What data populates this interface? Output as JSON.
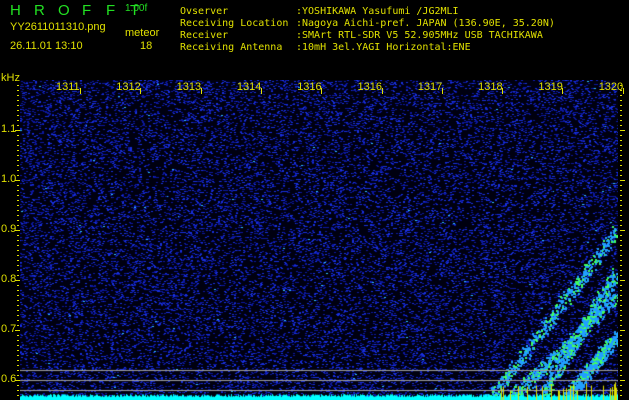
{
  "header": {
    "app_title": "HROFFT",
    "version": "1.00f",
    "filename": "YY2611011310.png",
    "datetime": "26.11.01 13:10",
    "meteor_label": "meteor",
    "meteor_count": "18",
    "info": [
      {
        "label": "Ovserver",
        "value": ":YOSHIKAWA Yasufumi /JG2MLI"
      },
      {
        "label": "Receiving Location",
        "value": ":Nagoya Aichi-pref. JAPAN (136.90E, 35.20N)"
      },
      {
        "label": "Receiver",
        "value": ":SMArt RTL-SDR V5 52.905MHz USB TACHIKAWA"
      },
      {
        "label": "Receiving Antenna",
        "value": ":10mH 3el.YAGI Horizontal:ENE"
      }
    ]
  },
  "chart_data": {
    "type": "heatmap",
    "title": "HROFFT spectrogram",
    "ylabel": "kHz",
    "xlabel": "",
    "x_ticks": [
      "1311",
      "1312",
      "1313",
      "1314",
      "1316",
      "1316",
      "1317",
      "1318",
      "1319",
      "1320"
    ],
    "y_ticks": [
      "1.1",
      "1.0",
      "0.9",
      "0.8",
      "0.7",
      "0.6"
    ],
    "ylim": [
      0.56,
      1.2
    ],
    "reference_lines_khz": [
      0.62,
      0.6,
      0.58
    ],
    "colors": {
      "background": "#000000",
      "noise": "#1020c0",
      "signal": "#30ff60",
      "baseline": "#00ffff",
      "axis": "#e0e000"
    }
  }
}
